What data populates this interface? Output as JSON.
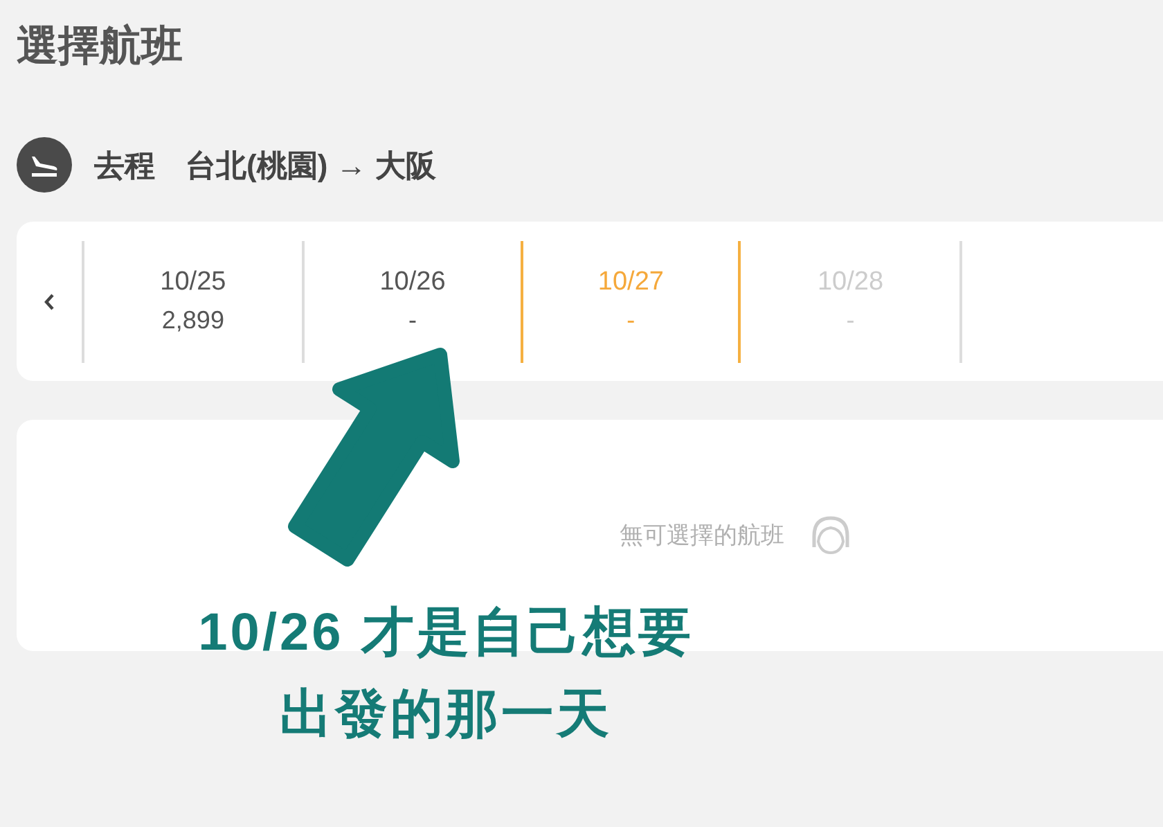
{
  "page_title": "選擇航班",
  "route": {
    "label": "去程",
    "origin": "台北(桃園)",
    "arrow": "→",
    "destination": "大阪"
  },
  "dates": [
    {
      "date": "10/25",
      "price": "2,899",
      "selected": false,
      "disabled": false
    },
    {
      "date": "10/26",
      "price": "-",
      "selected": false,
      "disabled": false
    },
    {
      "date": "10/27",
      "price": "-",
      "selected": true,
      "disabled": false
    },
    {
      "date": "10/28",
      "price": "-",
      "selected": false,
      "disabled": true
    }
  ],
  "empty_state": {
    "message": "無可選擇的航班"
  },
  "annotation": {
    "lines": [
      "10/26 才是自己想要",
      "出發的那一天"
    ]
  }
}
